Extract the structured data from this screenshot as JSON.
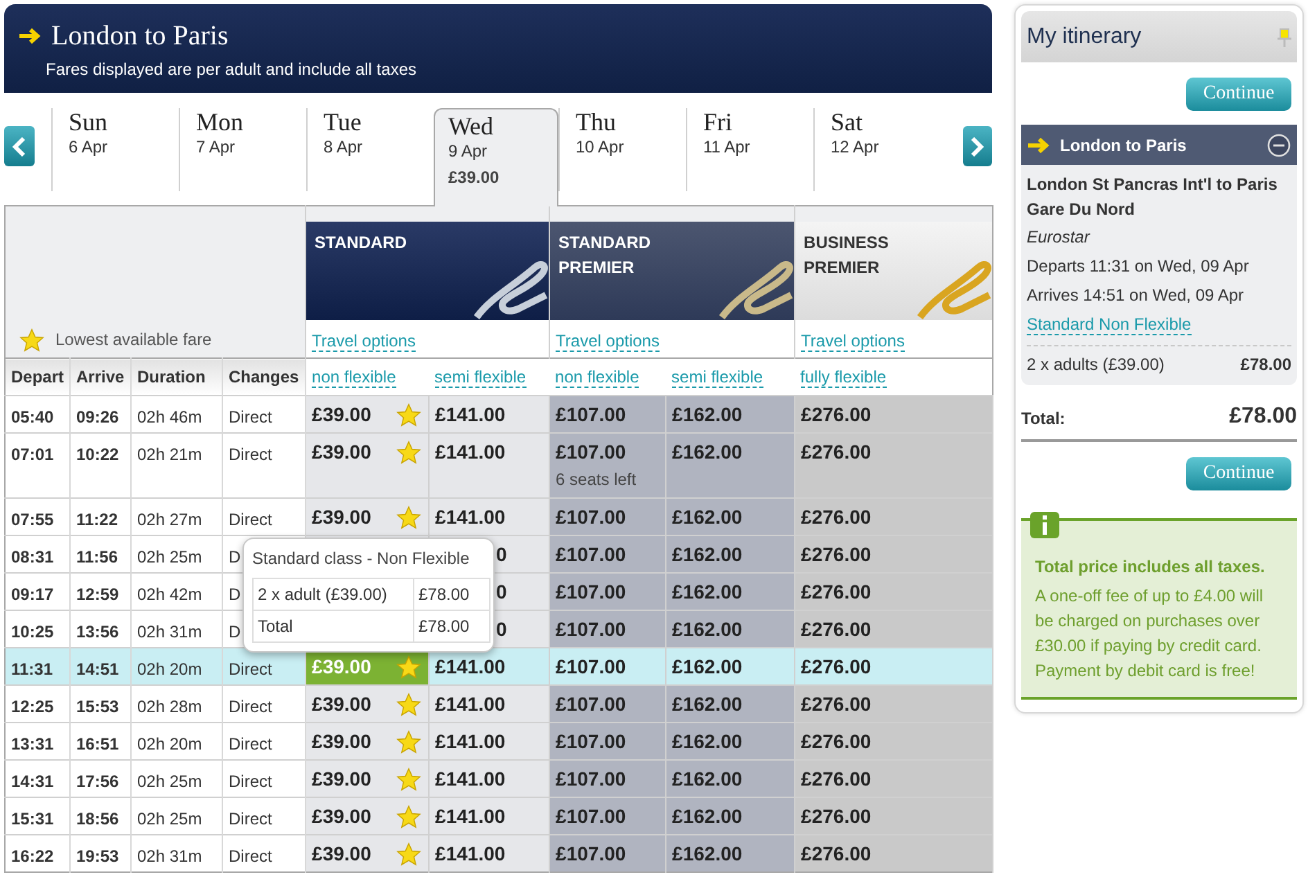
{
  "header": {
    "title": "London to Paris",
    "subtitle": "Fares displayed are per adult and include all taxes"
  },
  "days": [
    {
      "day": "Sun",
      "date": "6 Apr",
      "selected": false
    },
    {
      "day": "Mon",
      "date": "7 Apr",
      "selected": false
    },
    {
      "day": "Tue",
      "date": "8 Apr",
      "selected": false
    },
    {
      "day": "Wed",
      "date": "9 Apr",
      "price": "£39.00",
      "selected": true
    },
    {
      "day": "Thu",
      "date": "10 Apr",
      "selected": false
    },
    {
      "day": "Fri",
      "date": "11 Apr",
      "selected": false
    },
    {
      "day": "Sat",
      "date": "12 Apr",
      "selected": false
    }
  ],
  "legend": "Lowest available fare",
  "fare_classes": [
    {
      "name": "STANDARD",
      "kind": "standard",
      "link": "Travel options",
      "options": [
        "non flexible",
        "semi flexible"
      ]
    },
    {
      "name": "STANDARD PREMIER",
      "kind": "premier",
      "link": "Travel options",
      "options": [
        "non flexible",
        "semi flexible"
      ]
    },
    {
      "name": "BUSINESS PREMIER",
      "kind": "business",
      "link": "Travel options",
      "options": [
        "fully flexible"
      ]
    }
  ],
  "columns": [
    "Depart",
    "Arrive",
    "Duration",
    "Changes"
  ],
  "rows": [
    {
      "depart": "05:40",
      "arrive": "09:26",
      "duration": "02h 46m",
      "changes": "Direct",
      "selected": false,
      "fares": [
        {
          "price": "£39.00",
          "lowest": true,
          "selected": false
        },
        {
          "price": "£141.00",
          "selected": false
        },
        {
          "price": "£107.00",
          "selected": false
        },
        {
          "price": "£162.00",
          "selected": false
        },
        {
          "price": "£276.00",
          "selected": false
        }
      ]
    },
    {
      "depart": "07:01",
      "arrive": "10:22",
      "duration": "02h 21m",
      "changes": "Direct",
      "selected": false,
      "fares": [
        {
          "price": "£39.00",
          "lowest": true,
          "selected": false
        },
        {
          "price": "£141.00",
          "selected": false
        },
        {
          "price": "£107.00",
          "note": "6 seats left",
          "selected": false
        },
        {
          "price": "£162.00",
          "selected": false
        },
        {
          "price": "£276.00",
          "selected": false
        }
      ]
    },
    {
      "depart": "07:55",
      "arrive": "11:22",
      "duration": "02h 27m",
      "changes": "Direct",
      "selected": false,
      "fares": [
        {
          "price": "£39.00",
          "lowest": true,
          "selected": false
        },
        {
          "price": "£141.00",
          "selected": false
        },
        {
          "price": "£107.00",
          "selected": false
        },
        {
          "price": "£162.00",
          "selected": false
        },
        {
          "price": "£276.00",
          "selected": false
        }
      ]
    },
    {
      "depart": "08:31",
      "arrive": "11:56",
      "duration": "02h 25m",
      "changes": "D",
      "selected": false,
      "fares": [
        {
          "price": "0",
          "selected": false
        },
        {
          "price": "£107.00",
          "selected": false
        },
        {
          "price": "£162.00",
          "selected": false
        },
        {
          "price": "£276.00",
          "selected": false
        }
      ]
    },
    {
      "depart": "09:17",
      "arrive": "12:59",
      "duration": "02h 42m",
      "changes": "D",
      "selected": false,
      "fares": [
        {
          "price": "0",
          "selected": false
        },
        {
          "price": "£107.00",
          "selected": false
        },
        {
          "price": "£162.00",
          "selected": false
        },
        {
          "price": "£276.00",
          "selected": false
        }
      ]
    },
    {
      "depart": "10:25",
      "arrive": "13:56",
      "duration": "02h 31m",
      "changes": "D",
      "selected": false,
      "fares": [
        {
          "price": "0",
          "selected": false
        },
        {
          "price": "£107.00",
          "selected": false
        },
        {
          "price": "£162.00",
          "selected": false
        },
        {
          "price": "£276.00",
          "selected": false
        }
      ]
    },
    {
      "depart": "11:31",
      "arrive": "14:51",
      "duration": "02h 20m",
      "changes": "Direct",
      "selected": true,
      "fares": [
        {
          "price": "£39.00",
          "lowest": true,
          "selected": true
        },
        {
          "price": "£141.00",
          "selected": false
        },
        {
          "price": "£107.00",
          "selected": false
        },
        {
          "price": "£162.00",
          "selected": false
        },
        {
          "price": "£276.00",
          "selected": false
        }
      ]
    },
    {
      "depart": "12:25",
      "arrive": "15:53",
      "duration": "02h 28m",
      "changes": "Direct",
      "selected": false,
      "fares": [
        {
          "price": "£39.00",
          "lowest": true,
          "selected": false
        },
        {
          "price": "£141.00",
          "selected": false
        },
        {
          "price": "£107.00",
          "selected": false
        },
        {
          "price": "£162.00",
          "selected": false
        },
        {
          "price": "£276.00",
          "selected": false
        }
      ]
    },
    {
      "depart": "13:31",
      "arrive": "16:51",
      "duration": "02h 20m",
      "changes": "Direct",
      "selected": false,
      "fares": [
        {
          "price": "£39.00",
          "lowest": true,
          "selected": false
        },
        {
          "price": "£141.00",
          "selected": false
        },
        {
          "price": "£107.00",
          "selected": false
        },
        {
          "price": "£162.00",
          "selected": false
        },
        {
          "price": "£276.00",
          "selected": false
        }
      ]
    },
    {
      "depart": "14:31",
      "arrive": "17:56",
      "duration": "02h 25m",
      "changes": "Direct",
      "selected": false,
      "fares": [
        {
          "price": "£39.00",
          "lowest": true,
          "selected": false
        },
        {
          "price": "£141.00",
          "selected": false
        },
        {
          "price": "£107.00",
          "selected": false
        },
        {
          "price": "£162.00",
          "selected": false
        },
        {
          "price": "£276.00",
          "selected": false
        }
      ]
    },
    {
      "depart": "15:31",
      "arrive": "18:56",
      "duration": "02h 25m",
      "changes": "Direct",
      "selected": false,
      "fares": [
        {
          "price": "£39.00",
          "lowest": true,
          "selected": false
        },
        {
          "price": "£141.00",
          "selected": false
        },
        {
          "price": "£107.00",
          "selected": false
        },
        {
          "price": "£162.00",
          "selected": false
        },
        {
          "price": "£276.00",
          "selected": false
        }
      ]
    },
    {
      "depart": "16:22",
      "arrive": "19:53",
      "duration": "02h 31m",
      "changes": "Direct",
      "selected": false,
      "fares": [
        {
          "price": "£39.00",
          "lowest": true,
          "selected": false
        },
        {
          "price": "£141.00",
          "selected": false
        },
        {
          "price": "£107.00",
          "selected": false
        },
        {
          "price": "£162.00",
          "selected": false
        },
        {
          "price": "£276.00",
          "selected": false
        }
      ]
    }
  ],
  "tooltip": {
    "title": "Standard class - Non Flexible",
    "rows": [
      {
        "label": "2 x adult (£39.00)",
        "amount": "£78.00"
      },
      {
        "label": "Total",
        "amount": "£78.00"
      }
    ]
  },
  "itinerary": {
    "title": "My itinerary",
    "continue_top": "Continue",
    "journey": {
      "title": "London to Paris",
      "route": "London St Pancras Int'l to Paris Gare Du Nord",
      "operator": "Eurostar",
      "departs": "Departs 11:31 on Wed, 09 Apr",
      "arrives": "Arrives 14:51 on Wed, 09 Apr",
      "fare_link": "Standard Non Flexible",
      "passengers": "2 x adults (£39.00)",
      "amount": "£78.00"
    },
    "total_label": "Total:",
    "total": "£78.00",
    "continue_bottom": "Continue",
    "info": {
      "title": "Total price includes all taxes.",
      "text": "A one-off fee of up to £4.00 will be charged on purchases over £30.00 if paying by credit card. Payment by debit card is free!"
    }
  }
}
